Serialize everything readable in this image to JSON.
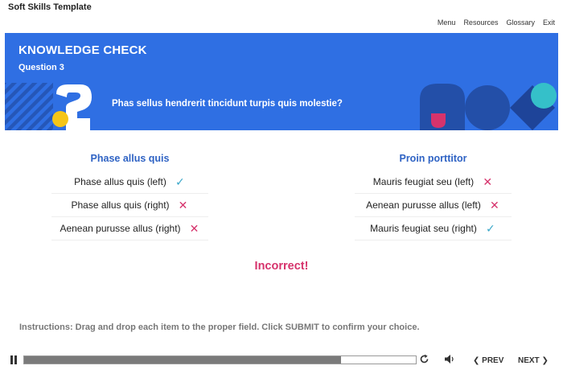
{
  "app": {
    "title": "Soft Skills Template"
  },
  "topnav": [
    "Menu",
    "Resources",
    "Glossary",
    "Exit"
  ],
  "banner": {
    "heading": "KNOWLEDGE CHECK",
    "subheading": "Question 3",
    "question": "Phas sellus hendrerit tincidunt turpis quis molestie?",
    "color": "#2f6fe3"
  },
  "columns": [
    {
      "title": "Phase allus quis",
      "items": [
        {
          "label": "Phase allus quis (left)",
          "result": "check-icon"
        },
        {
          "label": "Phase allus quis (right)",
          "result": "x-icon"
        },
        {
          "label": "Aenean purusse allus (right)",
          "result": "x-icon"
        }
      ]
    },
    {
      "title": "Proin porttitor",
      "items": [
        {
          "label": "Mauris feugiat seu (left)",
          "result": "x-icon"
        },
        {
          "label": "Aenean purusse allus (left)",
          "result": "x-icon"
        },
        {
          "label": "Mauris feugiat seu (right)",
          "result": "check-icon"
        }
      ]
    }
  ],
  "feedback": {
    "text": "Incorrect!",
    "color": "#d6336c"
  },
  "instructions": "Instructions: Drag and drop each item to the proper field. Click SUBMIT to confirm your choice.",
  "controls": {
    "progress": 0.81,
    "prev_label": "❮ PREV",
    "next_label": "NEXT ❯",
    "icons": [
      "pause-icon",
      "replay-icon",
      "volume-icon"
    ]
  }
}
